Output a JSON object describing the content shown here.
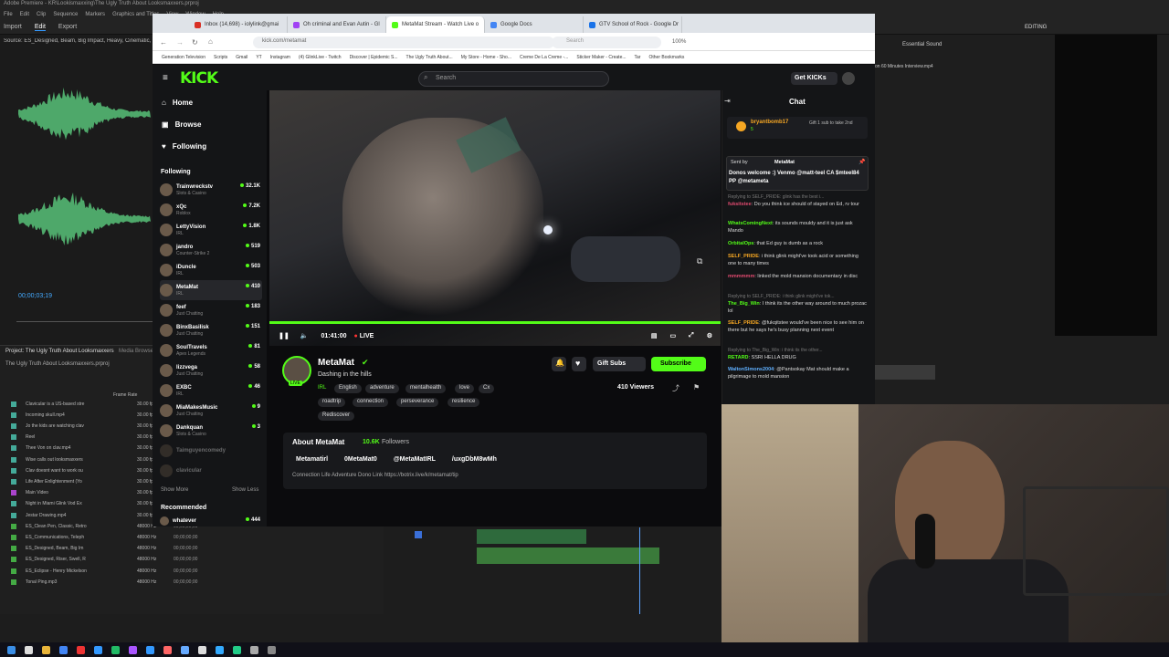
{
  "premiere": {
    "title": "Adobe Premiere - KR\\Lookismaxxing\\The Ugly Truth About Looksmaxxers.prproj",
    "menu": [
      "File",
      "Edit",
      "Clip",
      "Sequence",
      "Markers",
      "Graphics and Titles",
      "View",
      "Window",
      "Help"
    ],
    "workspaces": [
      "Import",
      "Edit",
      "Export"
    ],
    "source_label": "Source: ES_Designed, Beam, Big Impact, Heavy, Cinematic, Epic, Big Impact",
    "source_time": "00;00;03;19",
    "project_title": "Project: The Ugly Truth About Looksmaxxers",
    "media_browser": "Media Browser",
    "project_name": "The Ugly Truth About Looksmaxxers.prproj",
    "col_frame_rate": "Frame Rate",
    "editing_label": "EDITING",
    "essential_sound": "Essential Sound",
    "right_file": "on 60 Minutes Interview.mp4",
    "items": [
      {
        "name": "Clavicular is a US-based stre",
        "rate": "30.00 fps",
        "tc": "",
        "color": "#4a9"
      },
      {
        "name": "Incoming skull.mp4",
        "rate": "30.00 fps",
        "tc": "",
        "color": "#4a9"
      },
      {
        "name": "Jo the kids are watching clav",
        "rate": "30.00 fps",
        "tc": "",
        "color": "#4a9"
      },
      {
        "name": "Reel",
        "rate": "30.00 fps",
        "tc": "",
        "color": "#4a9"
      },
      {
        "name": "Thee Von on clav.mp4",
        "rate": "30.00 fps",
        "tc": "",
        "color": "#4a9"
      },
      {
        "name": "Wise calls out looksmaxxers",
        "rate": "30.00 fps",
        "tc": "",
        "color": "#4a9"
      },
      {
        "name": "Clav doesnt want to work ou",
        "rate": "30.00 fps",
        "tc": "",
        "color": "#4a9"
      },
      {
        "name": "Life After Enlightenment (Yo",
        "rate": "30.00 fps",
        "tc": "",
        "color": "#4a9"
      },
      {
        "name": "Main Video",
        "rate": "30.00 fps",
        "tc": "",
        "color": "#a4c"
      },
      {
        "name": "Night in Miami Glink Vod Ex",
        "rate": "30.00 fps",
        "tc": "",
        "color": "#4a9"
      },
      {
        "name": "Jestar Drawing.mp4",
        "rate": "30.00 fps",
        "tc": "00;00;00;00",
        "color": "#4a9"
      },
      {
        "name": "ES_Clean Pen, Classic, Retro",
        "rate": "48000 Hz",
        "tc": "00;00;00;00",
        "color": "#4a4"
      },
      {
        "name": "ES_Communications, Teleph",
        "rate": "48000 Hz",
        "tc": "00;00;00;00",
        "color": "#4a4"
      },
      {
        "name": "ES_Designed, Beam, Big Im",
        "rate": "48000 Hz",
        "tc": "00;00;00;00",
        "color": "#4a4"
      },
      {
        "name": "ES_Designed, Riser, Swell, R",
        "rate": "48000 Hz",
        "tc": "00;00;00;00",
        "color": "#4a4"
      },
      {
        "name": "ES_Eclipse - Henry Mickelson",
        "rate": "48000 Hz",
        "tc": "00;00;00;00",
        "color": "#4a4"
      },
      {
        "name": "Tonal Ping.mp3",
        "rate": "48000 Hz",
        "tc": "00;00;00;00",
        "color": "#4a4"
      }
    ]
  },
  "browser": {
    "tabs": [
      {
        "label": "Inbox (14,698) - iolylink@gmai",
        "active": false,
        "color": "#d93025"
      },
      {
        "label": "Oh criminal and Evan Autin - Gl",
        "active": false,
        "color": "#a142f4"
      },
      {
        "label": "MetaMat Stream - Watch Live o",
        "active": true,
        "color": "#53fc18"
      },
      {
        "label": "Google Docs",
        "active": false,
        "color": "#4285f4"
      },
      {
        "label": "GTV School of Rock - Google Dr",
        "active": false,
        "color": "#1a73e8"
      }
    ],
    "url": "kick.com/metamat",
    "search_placeholder": "Search",
    "zoom": "100%",
    "bookmarks": [
      "Generation Television",
      "Scripts",
      "Gmail",
      "YT",
      "Instagram",
      "(4) GlinkLive - Twitch",
      "Discover | Epidemic S...",
      "The Ugly Truth About...",
      "My Store - Home - Sho...",
      "Creme De La Creme -...",
      "Sticker Maker - Create...",
      "Tar",
      "Other Bookmarks"
    ]
  },
  "kick": {
    "search_placeholder": "Search",
    "get_kicks": "Get KICKs",
    "nav": {
      "home": "Home",
      "browse": "Browse",
      "following": "Following"
    },
    "following_label": "Following",
    "recommended_label": "Recommended",
    "show_more": "Show More",
    "show_less": "Show Less",
    "followed": [
      {
        "name": "Trainwreckstv",
        "cat": "Slots & Casino",
        "viewers": "32.1K"
      },
      {
        "name": "xQc",
        "cat": "Roblox",
        "viewers": "7.2K"
      },
      {
        "name": "LettyVision",
        "cat": "IRL",
        "viewers": "1.8K"
      },
      {
        "name": "jandro",
        "cat": "Counter-Strike 2",
        "viewers": "519"
      },
      {
        "name": "iDuncle",
        "cat": "IRL",
        "viewers": "503"
      },
      {
        "name": "MetaMat",
        "cat": "IRL",
        "viewers": "410",
        "selected": true
      },
      {
        "name": "feef",
        "cat": "Just Chatting",
        "viewers": "183"
      },
      {
        "name": "BinxBasilisk",
        "cat": "Just Chatting",
        "viewers": "151"
      },
      {
        "name": "SoulTravels",
        "cat": "Apex Legends",
        "viewers": "81"
      },
      {
        "name": "lizzvega",
        "cat": "Just Chatting",
        "viewers": "58"
      },
      {
        "name": "EXBC",
        "cat": "IRL",
        "viewers": "46"
      },
      {
        "name": "MiaMakesMusic",
        "cat": "Just Chatting",
        "viewers": "9"
      },
      {
        "name": "Dankquan",
        "cat": "Slots & Casino",
        "viewers": "3"
      },
      {
        "name": "Taimguyencomedy",
        "cat": "",
        "viewers": ""
      },
      {
        "name": "clavicular",
        "cat": "",
        "viewers": ""
      }
    ],
    "recommended": [
      {
        "name": "whatever",
        "viewers": "444"
      }
    ],
    "player": {
      "time": "01:41:00",
      "live": "LIVE"
    },
    "channel": {
      "name": "MetaMat",
      "title": "Dashing in the hills",
      "tags": [
        "IRL",
        "English",
        "adventure",
        "mentalhealth",
        "love",
        "Cx",
        "roadtrip",
        "connection",
        "perseverance",
        "resilience",
        "Rediscover"
      ],
      "viewers": "410 Viewers",
      "gift_subs": "Gift Subs",
      "subscribe": "Subscribe",
      "about_title": "About MetaMat",
      "followers": "10.6K",
      "followers_label": "Followers",
      "socials": [
        "Metamatirl",
        "0MetaMat0",
        "@MetaMatIRL",
        "/uxgDbM8wMh"
      ],
      "about_text": "Connection Life Adventure Dono Link https://botrix.live/k/metamat/tip"
    },
    "chat": {
      "title": "Chat",
      "pinned_user": "bryantbomb17",
      "pinned_count": "5",
      "pinned_gift": "Gift 1 sub to take 2nd",
      "donation_from": "MetaMat",
      "donation_label": "Sent by",
      "donation_text": "Donos welcome :) Venmo @matt-teel CA $mteel84 PP @metameta",
      "messages": [
        {
          "reply": "Replying to SELF_PRIDE: glink has the best i...",
          "user": "fuksitstee",
          "text": "Do you think ice should of stayed on Ed, rv tour",
          "cls": "p"
        },
        {
          "reply": "",
          "user": "WhatsComingNext",
          "text": "its sounds mouldy and it is just ask Mando",
          "cls": ""
        },
        {
          "reply": "",
          "user": "OrbitalOps",
          "text": "that Ed guy is dumb as a rock",
          "cls": ""
        },
        {
          "reply": "",
          "user": "SELF_PRIDE",
          "text": "i think glink might've took acid or something one to many times",
          "cls": "o"
        },
        {
          "reply": "",
          "user": "mmmmmm",
          "text": "linked the mold mansion documentary in disc",
          "cls": "p"
        },
        {
          "reply": "Replying to SELF_PRIDE: i think glink might've tok...",
          "user": "The_Big_Win",
          "text": "I think its the other way around to much prozac lol",
          "cls": ""
        },
        {
          "reply": "",
          "user": "SELF_PRIDE",
          "text": "@fukqitstee would've been nice to see him on there but he says he's busy planning next event",
          "cls": "o"
        },
        {
          "reply": "Replying to The_Big_Win: i think its the other...",
          "user": "RETARD",
          "text": "SSRI HELLA DRUG",
          "cls": ""
        },
        {
          "reply": "",
          "user": "WaltonSimons2004",
          "text": "@Pantsokay Mat should make a pilgrimage to mold mansion",
          "cls": "c"
        }
      ]
    }
  },
  "colors": {
    "kick_green": "#53fc18",
    "kick_bg": "#0b0b0d",
    "panel": "#141517"
  }
}
